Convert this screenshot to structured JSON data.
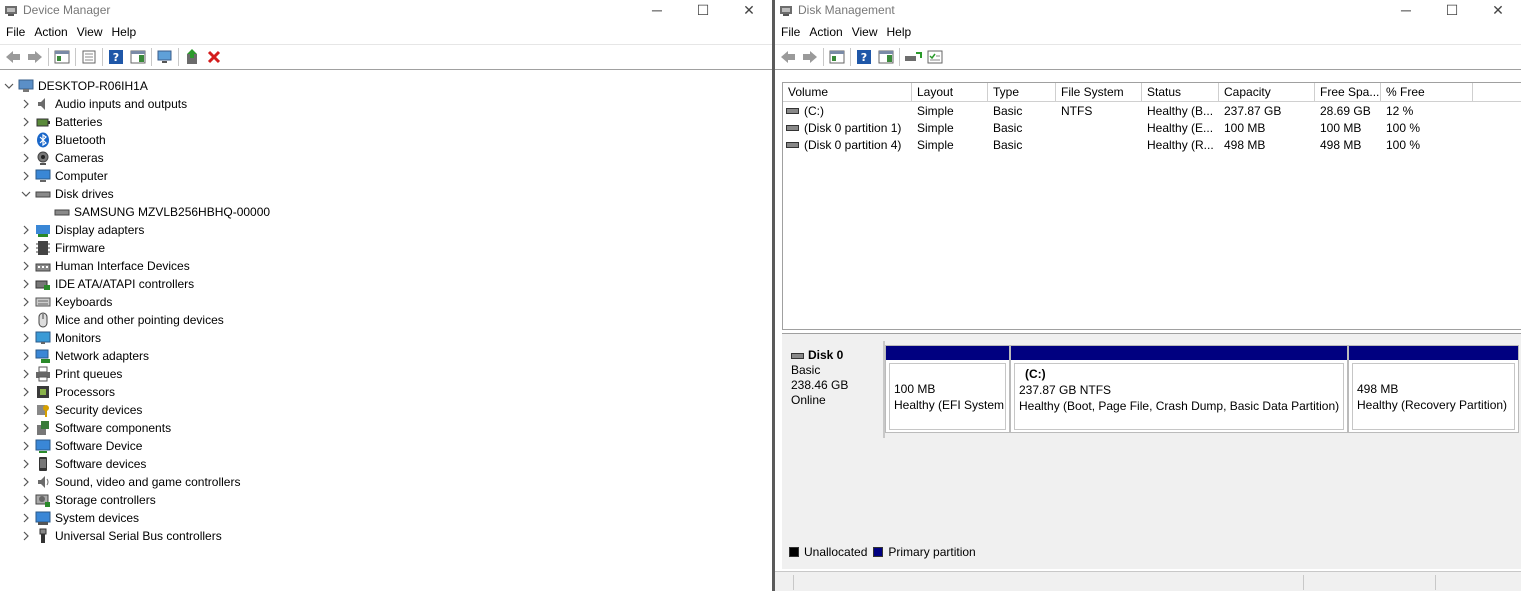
{
  "device_manager": {
    "title": "Device Manager",
    "menu": [
      "File",
      "Action",
      "View",
      "Help"
    ],
    "root": "DESKTOP-R06IH1A",
    "categories": [
      {
        "label": "Audio inputs and outputs",
        "icon": "speaker-icon"
      },
      {
        "label": "Batteries",
        "icon": "battery-icon"
      },
      {
        "label": "Bluetooth",
        "icon": "bluetooth-icon"
      },
      {
        "label": "Cameras",
        "icon": "camera-icon"
      },
      {
        "label": "Computer",
        "icon": "computer-icon"
      },
      {
        "label": "Disk drives",
        "icon": "disk-drive-icon",
        "expanded": true,
        "children": [
          "SAMSUNG MZVLB256HBHQ-00000"
        ]
      },
      {
        "label": "Display adapters",
        "icon": "display-adapter-icon"
      },
      {
        "label": "Firmware",
        "icon": "firmware-icon"
      },
      {
        "label": "Human Interface Devices",
        "icon": "hid-icon"
      },
      {
        "label": "IDE ATA/ATAPI controllers",
        "icon": "ide-controller-icon"
      },
      {
        "label": "Keyboards",
        "icon": "keyboard-icon"
      },
      {
        "label": "Mice and other pointing devices",
        "icon": "mouse-icon"
      },
      {
        "label": "Monitors",
        "icon": "monitor-icon"
      },
      {
        "label": "Network adapters",
        "icon": "network-adapter-icon"
      },
      {
        "label": "Print queues",
        "icon": "printer-icon"
      },
      {
        "label": "Processors",
        "icon": "processor-icon"
      },
      {
        "label": "Security devices",
        "icon": "security-device-icon"
      },
      {
        "label": "Software components",
        "icon": "software-component-icon"
      },
      {
        "label": "Software Device",
        "icon": "software-device-icon"
      },
      {
        "label": "Software devices",
        "icon": "phone-device-icon"
      },
      {
        "label": "Sound, video and game controllers",
        "icon": "sound-icon"
      },
      {
        "label": "Storage controllers",
        "icon": "storage-controller-icon"
      },
      {
        "label": "System devices",
        "icon": "system-device-icon"
      },
      {
        "label": "Universal Serial Bus controllers",
        "icon": "usb-icon"
      }
    ]
  },
  "disk_management": {
    "title": "Disk Management",
    "menu": [
      "File",
      "Action",
      "View",
      "Help"
    ],
    "columns": [
      "Volume",
      "Layout",
      "Type",
      "File System",
      "Status",
      "Capacity",
      "Free Spa...",
      "% Free"
    ],
    "rows": [
      [
        "(C:)",
        "Simple",
        "Basic",
        "NTFS",
        "Healthy (B...",
        "237.87 GB",
        "28.69 GB",
        "12 %"
      ],
      [
        "(Disk 0 partition 1)",
        "Simple",
        "Basic",
        "",
        "Healthy (E...",
        "100 MB",
        "100 MB",
        "100 %"
      ],
      [
        "(Disk 0 partition 4)",
        "Simple",
        "Basic",
        "",
        "Healthy (R...",
        "498 MB",
        "498 MB",
        "100 %"
      ]
    ],
    "disk": {
      "name": "Disk 0",
      "type": "Basic",
      "size": "238.46 GB",
      "state": "Online"
    },
    "partitions": [
      {
        "name": "",
        "size": "100 MB",
        "status": "Healthy (EFI System P"
      },
      {
        "name": "(C:)",
        "size": "237.87 GB NTFS",
        "status": "Healthy (Boot, Page File, Crash Dump, Basic Data Partition)"
      },
      {
        "name": "",
        "size": "498 MB",
        "status": "Healthy (Recovery Partition)"
      }
    ],
    "legend": {
      "unallocated": "Unallocated",
      "primary": "Primary partition"
    },
    "colors": {
      "unallocated": "#000000",
      "primary": "#000080"
    }
  },
  "window_controls": {
    "minimize": "─",
    "maximize": "☐",
    "close": "✕"
  }
}
